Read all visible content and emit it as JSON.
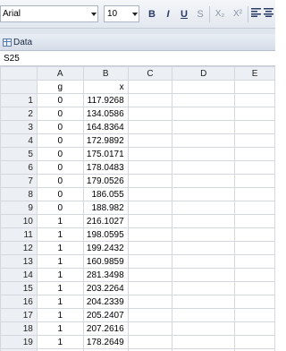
{
  "toolbar": {
    "font_name": "Arial",
    "font_size": "10",
    "bold": "B",
    "italic": "I",
    "underline": "U",
    "strike": "S",
    "subscript": "X₂",
    "superscript": "X²"
  },
  "panel": {
    "title": "Data"
  },
  "cell_ref": "S25",
  "columns": [
    "A",
    "B",
    "C",
    "D",
    "E"
  ],
  "rows": [
    {
      "n": "",
      "a": "g",
      "b": "x"
    },
    {
      "n": "1",
      "a": "0",
      "b": "117.9268"
    },
    {
      "n": "2",
      "a": "0",
      "b": "134.0586"
    },
    {
      "n": "3",
      "a": "0",
      "b": "164.8364"
    },
    {
      "n": "4",
      "a": "0",
      "b": "172.9892"
    },
    {
      "n": "5",
      "a": "0",
      "b": "175.0171"
    },
    {
      "n": "6",
      "a": "0",
      "b": "178.0483"
    },
    {
      "n": "7",
      "a": "0",
      "b": "179.0526"
    },
    {
      "n": "8",
      "a": "0",
      "b": "186.055"
    },
    {
      "n": "9",
      "a": "0",
      "b": "188.982"
    },
    {
      "n": "10",
      "a": "1",
      "b": "216.1027"
    },
    {
      "n": "11",
      "a": "1",
      "b": "198.0595"
    },
    {
      "n": "12",
      "a": "1",
      "b": "199.2432"
    },
    {
      "n": "13",
      "a": "1",
      "b": "160.9859"
    },
    {
      "n": "14",
      "a": "1",
      "b": "281.3498"
    },
    {
      "n": "15",
      "a": "1",
      "b": "203.2264"
    },
    {
      "n": "16",
      "a": "1",
      "b": "204.2339"
    },
    {
      "n": "17",
      "a": "1",
      "b": "205.2407"
    },
    {
      "n": "18",
      "a": "1",
      "b": "207.2616"
    },
    {
      "n": "19",
      "a": "1",
      "b": "178.2649"
    },
    {
      "n": "20",
      "a": "",
      "b": ""
    }
  ]
}
